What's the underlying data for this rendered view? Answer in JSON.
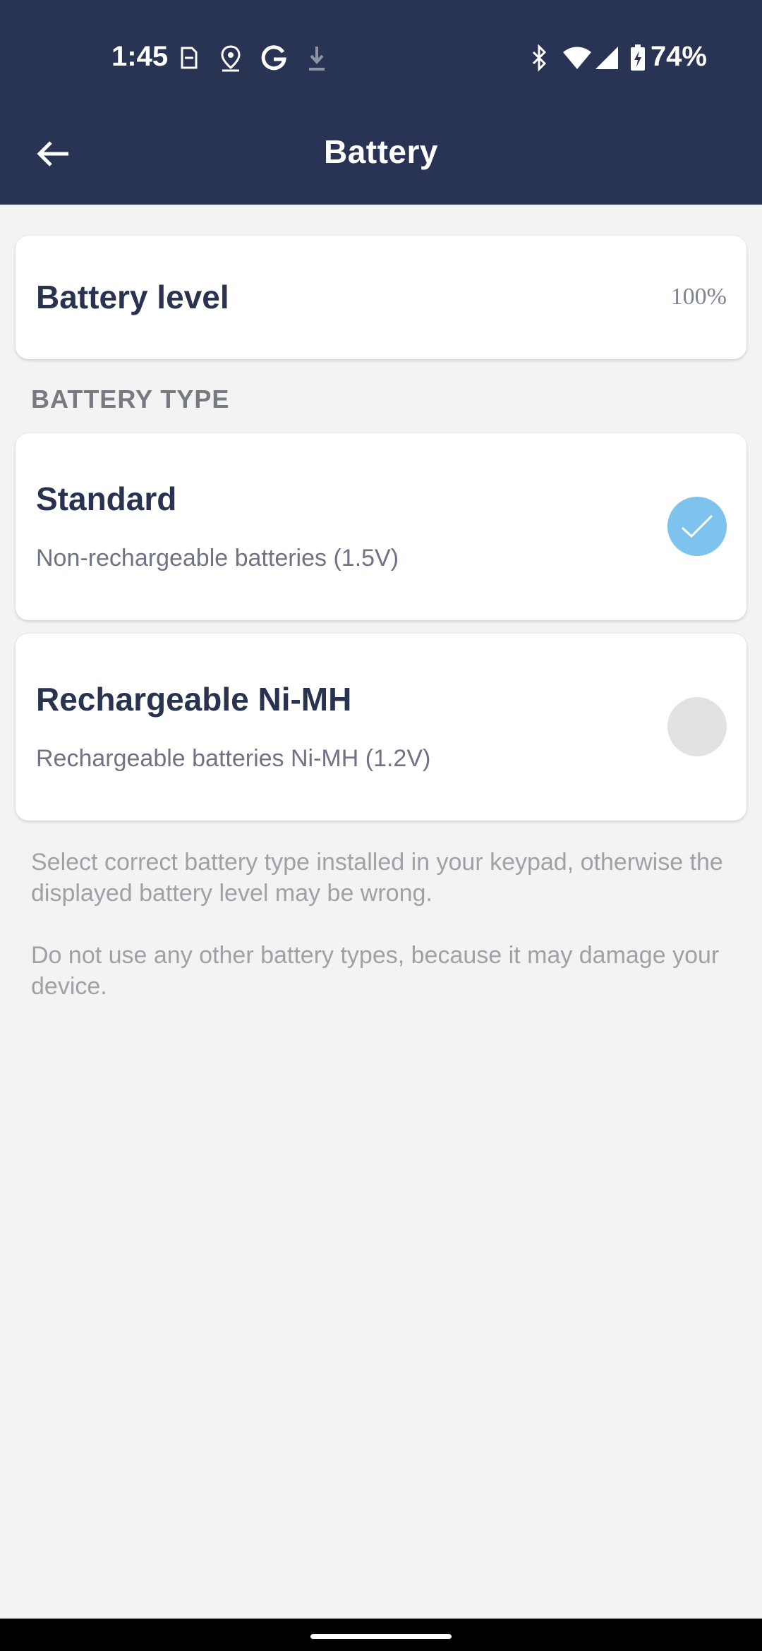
{
  "status_bar": {
    "time": "1:45",
    "battery_percent": "74%",
    "icons": [
      "sim-card-icon",
      "location-icon",
      "google-icon",
      "download-icon",
      "bluetooth-icon",
      "wifi-icon",
      "signal-icon",
      "battery-charging-icon"
    ]
  },
  "app_bar": {
    "title": "Battery",
    "back_icon": "arrow-left-icon"
  },
  "battery_level": {
    "label": "Battery level",
    "value": "100%"
  },
  "battery_type": {
    "header": "BATTERY TYPE",
    "options": [
      {
        "title": "Standard",
        "subtitle": "Non-rechargeable batteries (1.5V)",
        "selected": true
      },
      {
        "title": "Rechargeable Ni-MH",
        "subtitle": "Rechargeable batteries Ni-MH (1.2V)",
        "selected": false
      }
    ]
  },
  "notes": [
    "Select correct battery type installed in your keypad, otherwise the displayed battery level may be wrong.",
    "Do not use any other battery types, because it may damage your device."
  ],
  "colors": {
    "header_bg": "#293353",
    "selected_radio": "#7dc3ed",
    "unselected_radio": "#e2e2e2",
    "page_bg": "#f3f3f3"
  }
}
